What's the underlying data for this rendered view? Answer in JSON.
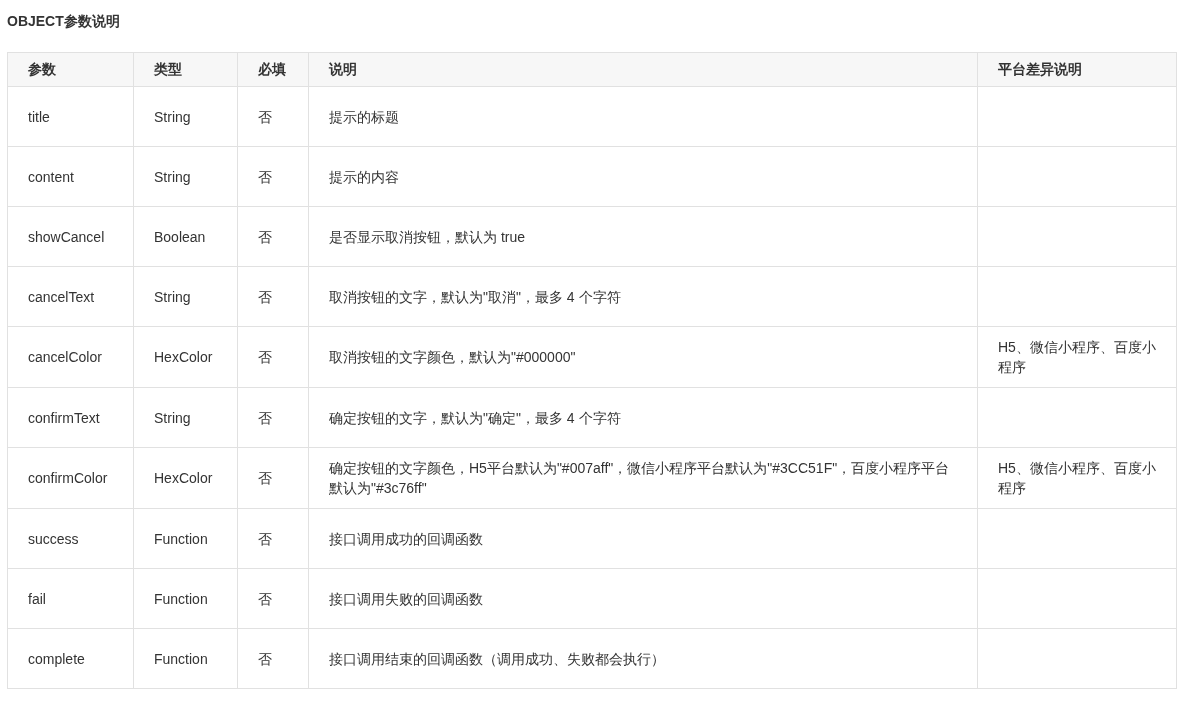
{
  "section_title": "OBJECT参数说明",
  "table": {
    "columns": [
      "参数",
      "类型",
      "必填",
      "说明",
      "平台差异说明"
    ],
    "rows": [
      {
        "param": "title",
        "type": "String",
        "required": "否",
        "description": "提示的标题"
      },
      {
        "param": "content",
        "type": "String",
        "required": "否",
        "description": "提示的内容"
      },
      {
        "param": "showCancel",
        "type": "Boolean",
        "required": "否",
        "description": "是否显示取消按钮，默认为 true"
      },
      {
        "param": "cancelText",
        "type": "String",
        "required": "否",
        "description": "取消按钮的文字，默认为\"取消\"，最多 4 个字符"
      },
      {
        "param": "cancelColor",
        "type": "HexColor",
        "required": "否",
        "description": "取消按钮的文字颜色，默认为\"#000000\"",
        "platform": "H5、微信小程序、百度小程序"
      },
      {
        "param": "confirmText",
        "type": "String",
        "required": "否",
        "description": "确定按钮的文字，默认为\"确定\"，最多 4 个字符"
      },
      {
        "param": "confirmColor",
        "type": "HexColor",
        "required": "否",
        "description": "确定按钮的文字颜色，H5平台默认为\"#007aff\"，微信小程序平台默认为\"#3CC51F\"，百度小程序平台默认为\"#3c76ff\"",
        "platform": "H5、微信小程序、百度小程序"
      },
      {
        "param": "success",
        "type": "Function",
        "required": "否",
        "description": "接口调用成功的回调函数"
      },
      {
        "param": "fail",
        "type": "Function",
        "required": "否",
        "description": "接口调用失败的回调函数"
      },
      {
        "param": "complete",
        "type": "Function",
        "required": "否",
        "description": "接口调用结束的回调函数（调用成功、失败都会执行）"
      }
    ]
  }
}
